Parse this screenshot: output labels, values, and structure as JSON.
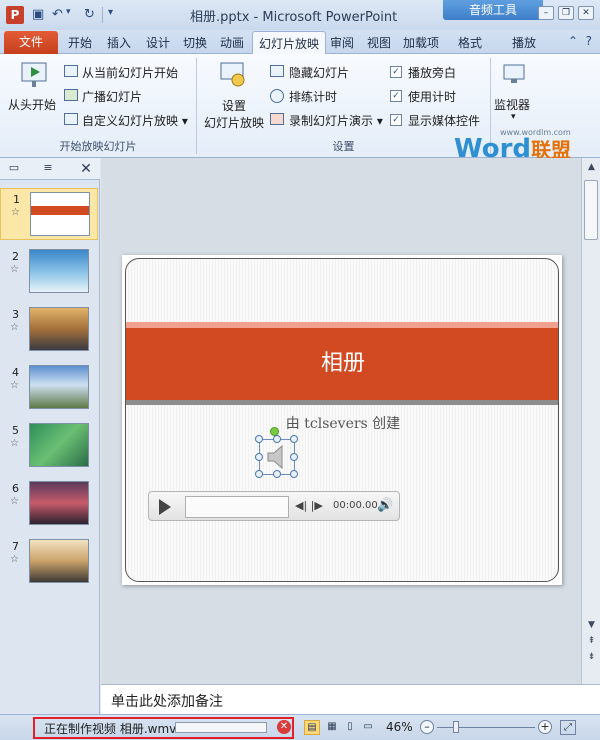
{
  "window": {
    "title": "相册.pptx - Microsoft PowerPoint",
    "context_header": "音频工具"
  },
  "quick_access": {
    "undo": "↶",
    "redo": "↻"
  },
  "tabs": {
    "file": "文件",
    "items": [
      "开始",
      "插入",
      "设计",
      "切换",
      "动画",
      "幻灯片放映",
      "审阅",
      "视图",
      "加载项",
      "格式",
      "播放"
    ],
    "active": "幻灯片放映"
  },
  "ribbon": {
    "group1": {
      "label": "开始放映幻灯片",
      "from_start": "从头开始",
      "from_current": "从当前幻灯片开始",
      "broadcast": "广播幻灯片",
      "custom": "自定义幻灯片放映 ▾"
    },
    "group2": {
      "label": "设置",
      "setup_line1": "设置",
      "setup_line2": "幻灯片放映",
      "hide": "隐藏幻灯片",
      "rehearse": "排练计时",
      "record": "录制幻灯片演示 ▾",
      "narration": "播放旁白",
      "timings": "使用计时",
      "media_controls": "显示媒体控件"
    },
    "group3": {
      "monitors": "监视器"
    }
  },
  "thumbnails": [
    "1",
    "2",
    "3",
    "4",
    "5",
    "6",
    "7"
  ],
  "slide": {
    "title": "相册",
    "subtitle": "由 tclsevers 创建",
    "media_time": "00:00.00"
  },
  "notes": {
    "placeholder": "单击此处添加备注"
  },
  "status": {
    "progress_text": "正在制作视频  相册.wmv",
    "zoom": "46%"
  },
  "watermark": {
    "brand": "Word",
    "brand_cn": "联盟",
    "url": "www.wordlm.com"
  },
  "colors": {
    "accent": "#d24a21",
    "file_tab": "#c63f1d",
    "context_tab": "#3e7ec9"
  }
}
